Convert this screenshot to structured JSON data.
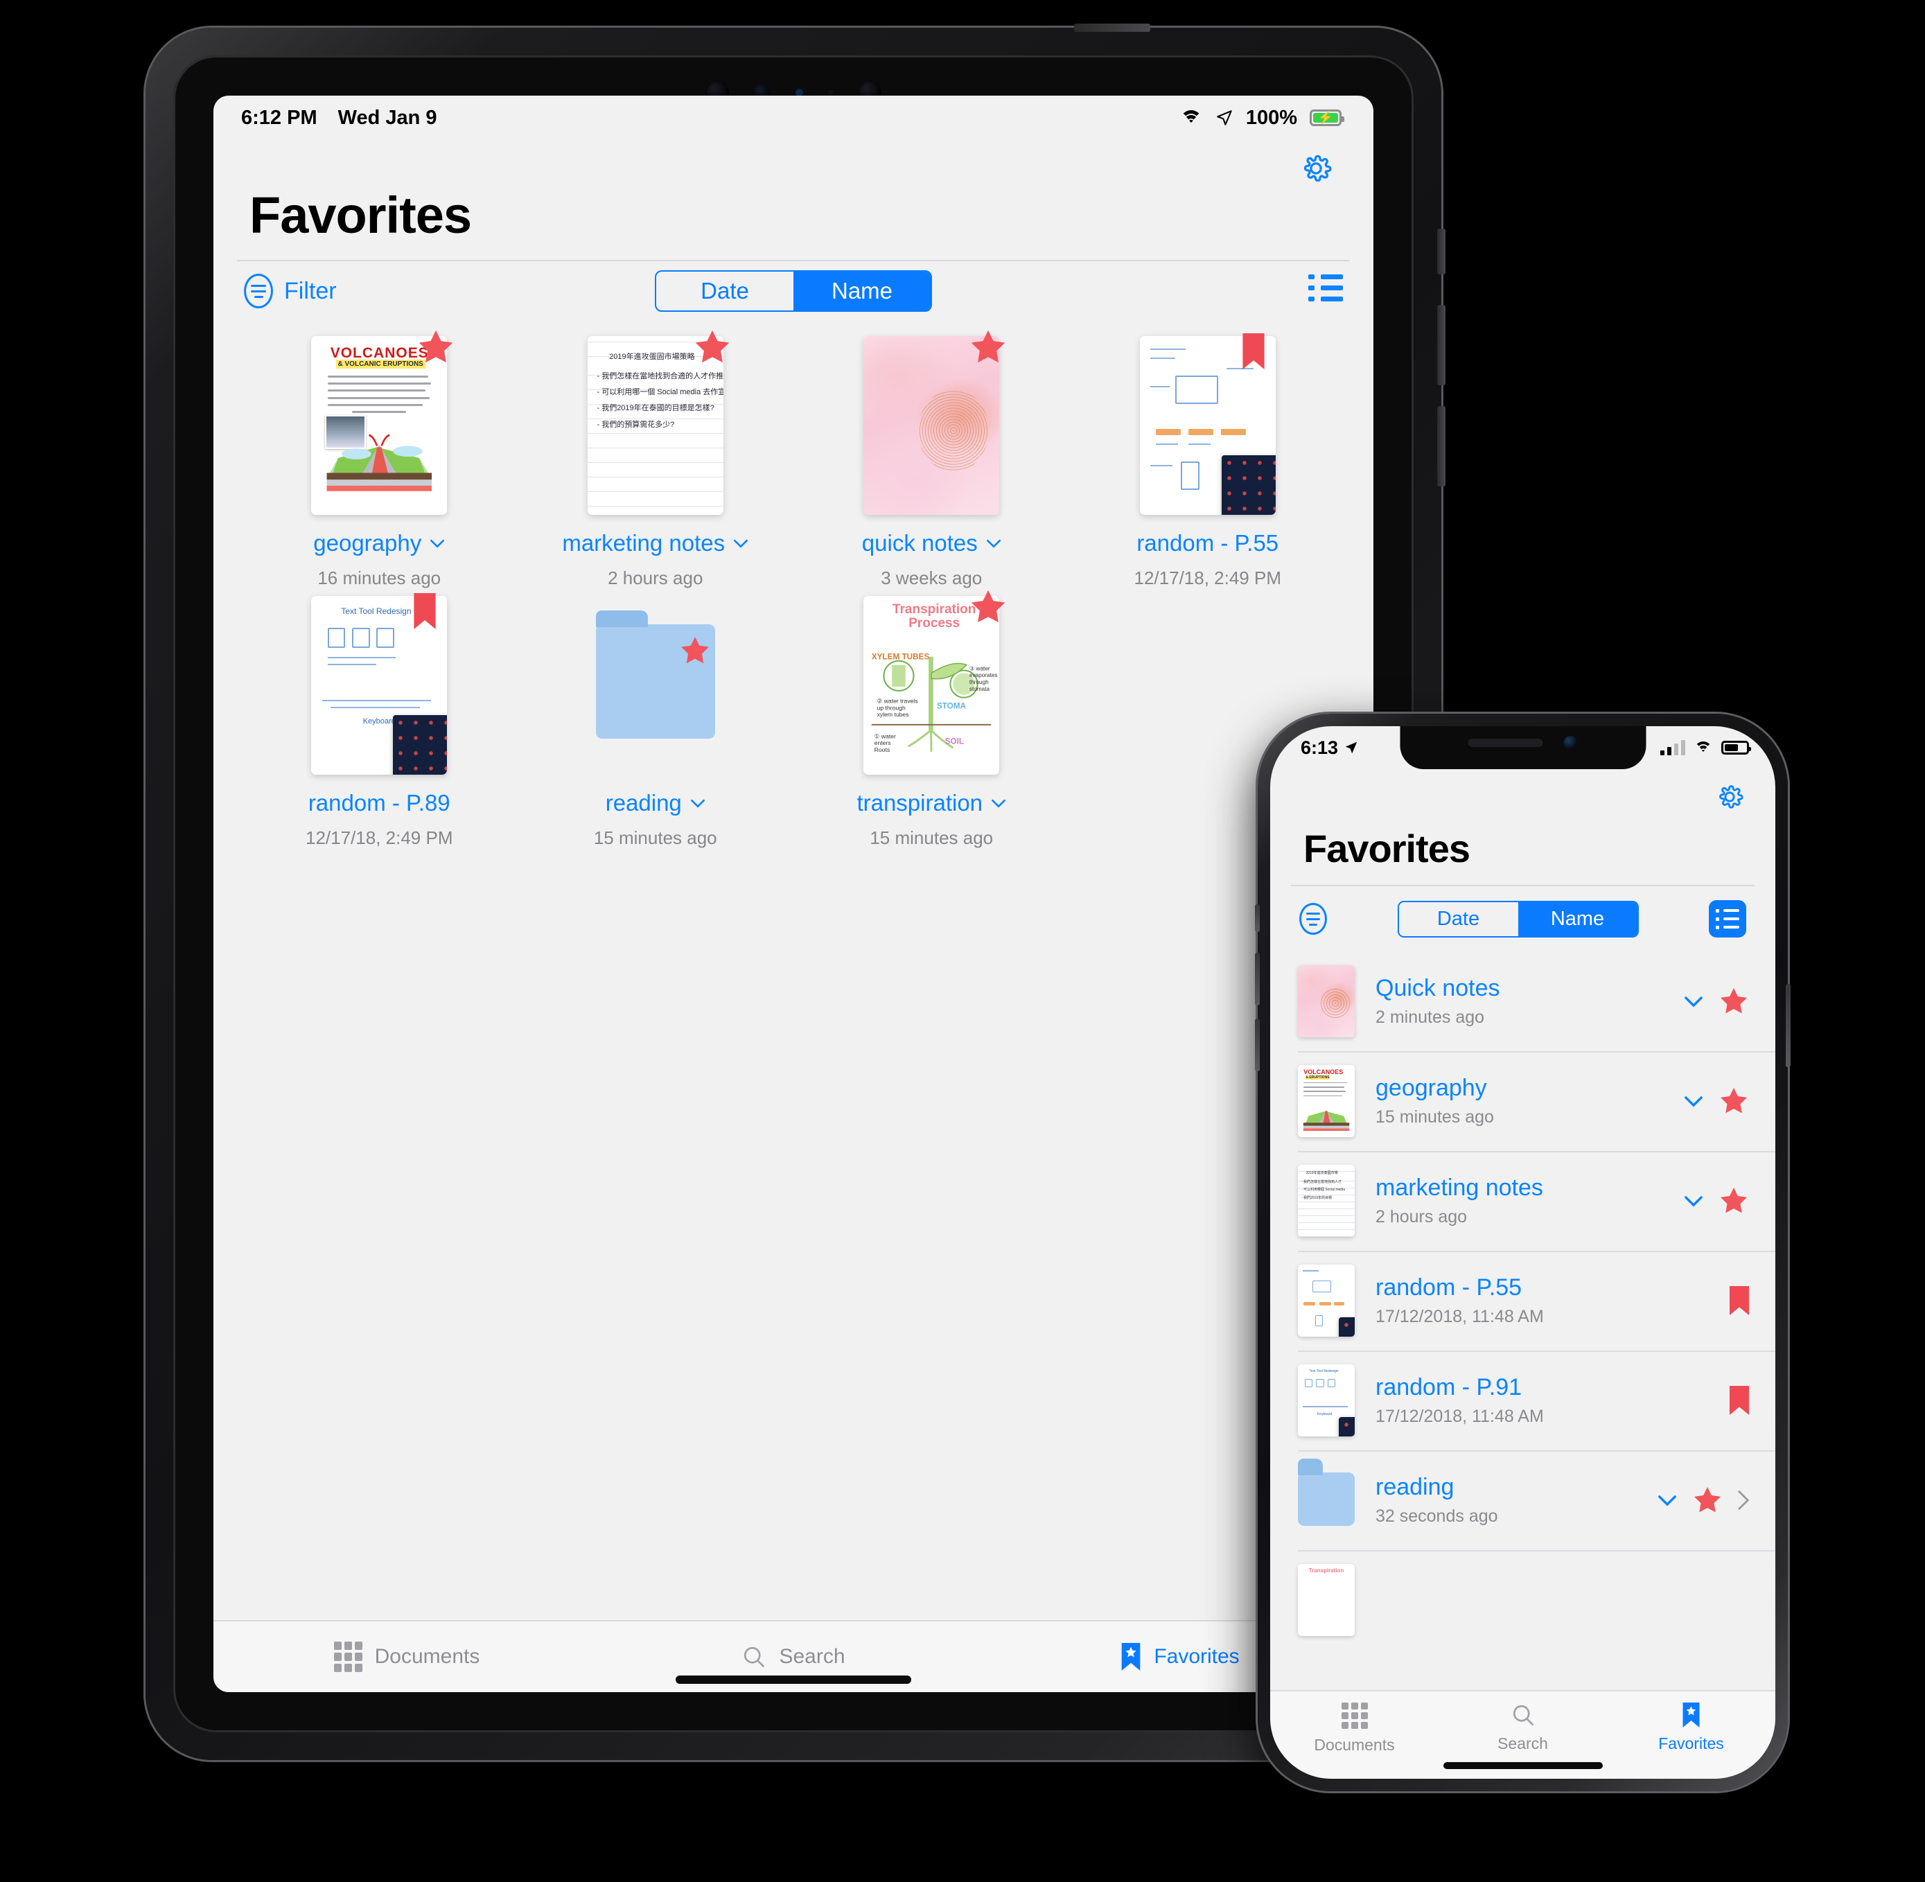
{
  "ipad": {
    "status": {
      "time": "6:12 PM",
      "date": "Wed Jan 9",
      "battery_percent": "100%",
      "wifi_icon": "wifi-icon",
      "location_icon": "location-arrow-icon",
      "battery_icon": "battery-charging-icon"
    },
    "gear_icon": "gear-icon",
    "title": "Favorites",
    "toolbar": {
      "filter_label": "Filter",
      "filter_icon": "filter-icon",
      "segments": [
        {
          "label": "Date",
          "selected": false
        },
        {
          "label": "Name",
          "selected": true
        }
      ],
      "list_view_icon": "list-view-icon"
    },
    "grid": [
      {
        "name": "geography",
        "date": "16 minutes ago",
        "chevron": true,
        "badge": "star",
        "art": "volcano"
      },
      {
        "name": "marketing notes",
        "date": "2 hours ago",
        "chevron": true,
        "badge": "star",
        "art": "chinese-notes"
      },
      {
        "name": "quick notes",
        "date": "3 weeks ago",
        "chevron": true,
        "badge": "star",
        "art": "pink-abstract"
      },
      {
        "name": "random - P.55",
        "date": "12/17/18, 2:49 PM",
        "chevron": false,
        "badge": "bookmark",
        "art": "diagram-page"
      },
      {
        "name": "random - P.89",
        "date": "12/17/18, 2:49 PM",
        "chevron": false,
        "badge": "bookmark",
        "art": "diagram-page2"
      },
      {
        "name": "reading",
        "date": "15 minutes ago",
        "chevron": true,
        "badge": "star",
        "art": "folder"
      },
      {
        "name": "transpiration",
        "date": "15 minutes ago",
        "chevron": true,
        "badge": "star",
        "art": "transpiration"
      }
    ],
    "tabs": [
      {
        "label": "Documents",
        "icon": "documents-grid-icon",
        "active": false
      },
      {
        "label": "Search",
        "icon": "search-icon",
        "active": false
      },
      {
        "label": "Favorites",
        "icon": "favorites-bookmark-icon",
        "active": true
      }
    ]
  },
  "iphone": {
    "status": {
      "time": "6:13",
      "location_icon": "location-arrow-icon",
      "signal_icon": "cellular-bars-icon",
      "wifi_icon": "wifi-icon",
      "battery_icon": "battery-icon"
    },
    "gear_icon": "gear-icon",
    "title": "Favorites",
    "toolbar": {
      "filter_icon": "filter-icon",
      "segments": [
        {
          "label": "Date",
          "selected": false
        },
        {
          "label": "Name",
          "selected": true
        }
      ],
      "list_view_icon": "list-view-icon"
    },
    "rows": [
      {
        "name": "Quick notes",
        "date": "2 minutes ago",
        "chevron": true,
        "badge": "star",
        "disclosure": false,
        "art": "pink-abstract"
      },
      {
        "name": "geography",
        "date": "15 minutes ago",
        "chevron": true,
        "badge": "star",
        "disclosure": false,
        "art": "volcano"
      },
      {
        "name": "marketing notes",
        "date": "2 hours ago",
        "chevron": true,
        "badge": "star",
        "disclosure": false,
        "art": "chinese-notes"
      },
      {
        "name": "random - P.55",
        "date": "17/12/2018, 11:48 AM",
        "chevron": false,
        "badge": "bookmark",
        "disclosure": false,
        "art": "diagram-page"
      },
      {
        "name": "random - P.91",
        "date": "17/12/2018, 11:48 AM",
        "chevron": false,
        "badge": "bookmark",
        "disclosure": false,
        "art": "diagram-page2"
      },
      {
        "name": "reading",
        "date": "32 seconds ago",
        "chevron": true,
        "badge": "star",
        "disclosure": true,
        "art": "folder"
      }
    ],
    "tabs": [
      {
        "label": "Documents",
        "icon": "documents-grid-icon",
        "active": false
      },
      {
        "label": "Search",
        "icon": "search-icon",
        "active": false
      },
      {
        "label": "Favorites",
        "icon": "favorites-bookmark-icon",
        "active": true
      }
    ]
  },
  "colors": {
    "accent": "#0a84ff",
    "segment_blue": "#0a7bff",
    "star_red": "#f2545b",
    "bookmark_red": "#ef4a54",
    "secondary_text": "#8a8a8f",
    "background": "#f1f1f2"
  }
}
